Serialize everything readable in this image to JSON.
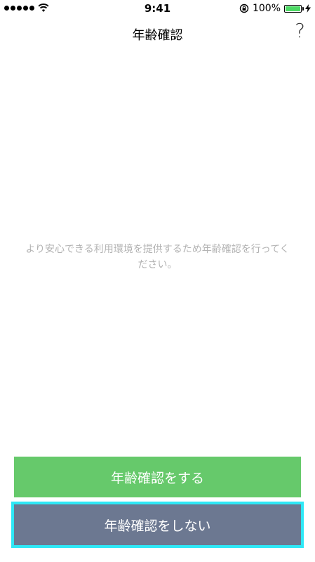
{
  "status_bar": {
    "time": "9:41",
    "battery_percent": "100%",
    "battery_level": 1.0,
    "signal_bars": 5,
    "icons": [
      "signal-dots-icon",
      "wifi-icon",
      "orientation-lock-icon",
      "battery-icon",
      "charging-bolt-icon"
    ]
  },
  "nav": {
    "title": "年齢確認",
    "help_label": "?"
  },
  "message": {
    "text": "より安心できる利用環境を提供するため年齢確認を行ってください。"
  },
  "buttons": {
    "confirm_label": "年齢確認をする",
    "skip_label": "年齢確認をしない"
  },
  "colors": {
    "confirm_button": "#66c96b",
    "skip_button": "#6c7891",
    "highlight": "#2ee8f6",
    "message_text": "#b3b3b3"
  }
}
